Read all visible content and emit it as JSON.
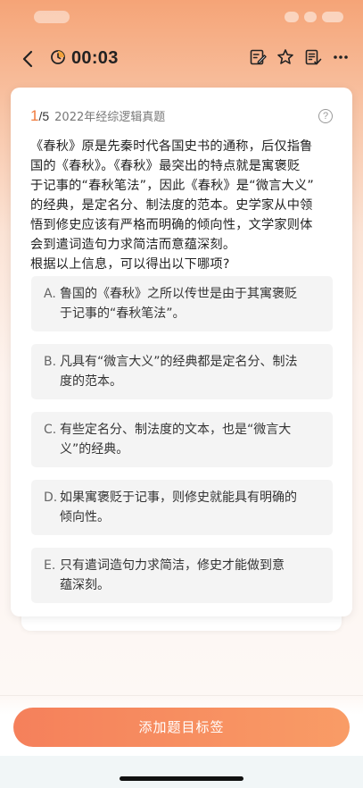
{
  "header": {
    "timer": "00:03",
    "icons": [
      "back-chevron-icon",
      "timer-clock-icon",
      "edit-note-icon",
      "star-icon",
      "answer-sheet-icon",
      "more-icon"
    ]
  },
  "question": {
    "index": "1",
    "total": "/5",
    "source": "2022年经综逻辑真题",
    "help_icon": "?",
    "stem_lines": [
      "《春秋》原是先秦时代各国史书的通称，后仅指鲁",
      "国的《春秋》。《春秋》最突出的特点就是寓褒贬",
      "于记事的“春秋笔法”，因此《春秋》是“微言大义”",
      "的经典，是定名分、制法度的范本。史学家从中领",
      "悟到修史应该有严格而明确的倾向性，文学家则体",
      "会到遣词造句力求简洁而意蕴深刻。",
      "根据以上信息，可以得出以下哪项?"
    ],
    "options": [
      {
        "letter": "A.",
        "lines": [
          "鲁国的《春秋》之所以传世是由于其寓褒贬",
          "于记事的“春秋笔法”。"
        ]
      },
      {
        "letter": "B.",
        "lines": [
          "凡具有“微言大义”的经典都是定名分、制法",
          "度的范本。"
        ]
      },
      {
        "letter": "C.",
        "lines": [
          "有些定名分、制法度的文本，也是“微言大",
          "义”的经典。"
        ]
      },
      {
        "letter": "D.",
        "lines": [
          "如果寓褒贬于记事，则修史就能具有明确的",
          "倾向性。"
        ]
      },
      {
        "letter": "E.",
        "lines": [
          "只有遣词造句力求简洁，修史才能做到意",
          "蕴深刻。"
        ]
      }
    ]
  },
  "footer": {
    "tag_button": "添加题目标签"
  },
  "colors": {
    "accent": "#f07a3c",
    "button_start": "#f5805b",
    "button_end": "#f99c66"
  }
}
